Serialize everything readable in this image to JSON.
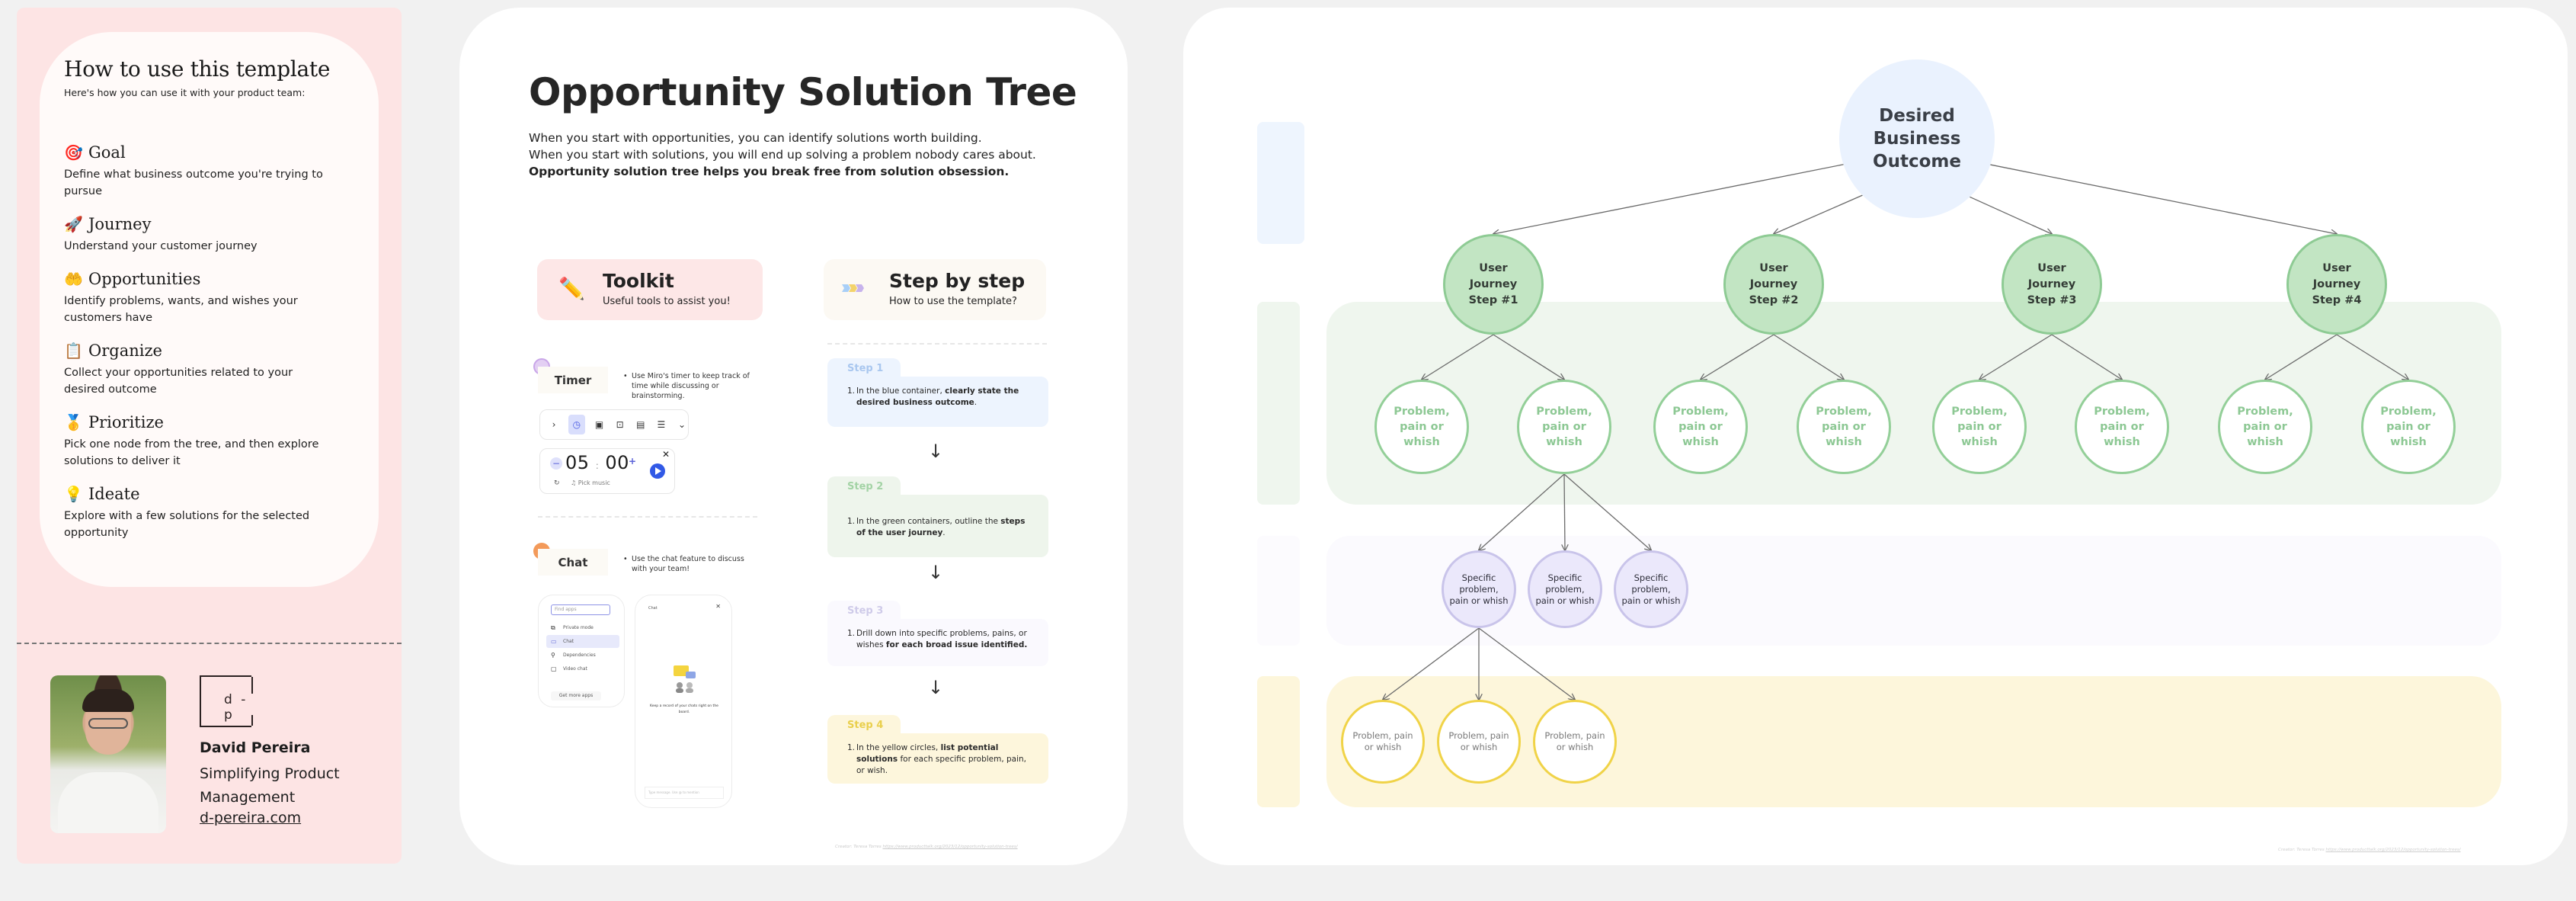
{
  "how_to": {
    "title": "How to use this template",
    "subtitle": "Here's how you can use it with your product team:",
    "items": [
      {
        "icon": "🎯",
        "icon_name": "target-icon",
        "label": "Goal",
        "desc": "Define what business outcome you're trying to pursue"
      },
      {
        "icon": "🚀",
        "icon_name": "rocket-icon",
        "label": "Journey",
        "desc": "Understand your customer journey"
      },
      {
        "icon": "🤲",
        "icon_name": "open-hands-icon",
        "label": "Opportunities",
        "desc": "Identify problems, wants, and wishes your customers have"
      },
      {
        "icon": "📋",
        "icon_name": "clipboard-icon",
        "label": "Organize",
        "desc": "Collect your opportunities related to your desired outcome"
      },
      {
        "icon": "🥇",
        "icon_name": "medal-icon",
        "label": "Prioritize",
        "desc": "Pick one node from the tree, and then explore solutions to deliver it"
      },
      {
        "icon": "💡",
        "icon_name": "lightbulb-icon",
        "label": "Ideate",
        "desc": "Explore with a few solutions for the selected opportunity"
      }
    ]
  },
  "author": {
    "logo_text": "d - p",
    "name": "David Pereira",
    "tagline": "Simplifying Product Management",
    "link": "d-pereira.com"
  },
  "intro": {
    "title": "Opportunity Solution Tree",
    "line1": "When you start with opportunities, you can identify solutions worth building.",
    "line2": "When you start with solutions, you will end up solving a problem nobody cares about.",
    "line3": "Opportunity solution tree helps you break free from solution obsession."
  },
  "toolkit": {
    "title": "Toolkit",
    "subtitle": "Useful tools to assist you!",
    "timer": {
      "label": "Timer",
      "note": "Use Miro's timer to keep track of time while discussing or brainstorming.",
      "minutes": "05",
      "seconds": "00",
      "separator": ":",
      "music_label": "Pick music",
      "toolbar_icons": [
        "chevron-right-icon",
        "timer-icon",
        "card-icon",
        "focus-icon",
        "calendar-icon",
        "notes-icon",
        "chevrons-down-icon"
      ]
    },
    "chat": {
      "label": "Chat",
      "note": "Use the chat feature to discuss with your team!",
      "apps_search_placeholder": "Find apps",
      "apps": [
        "Private mode",
        "Chat",
        "Dependencies",
        "Video chat"
      ],
      "apps_selected": "Chat",
      "get_more": "Get more apps",
      "panel_title": "Chat",
      "empty_text": "Keep a record of your chats right on the board.",
      "input_placeholder": "Type message. Use @ to mention"
    }
  },
  "steps": {
    "title": "Step by step",
    "subtitle": "How to use the template?",
    "items": [
      {
        "label": "Step 1",
        "num": "1.",
        "pre": "In the blue container, ",
        "bold": "clearly state the desired business outcome",
        "post": ".",
        "tab_color": "#a9c7ef",
        "bg": "#edf4fe"
      },
      {
        "label": "Step 2",
        "num": "1.",
        "pre": "In the green containers, outline the ",
        "bold": "steps of the user journey",
        "post": ".",
        "tab_color": "#a3d3a5",
        "bg": "#eef5ec"
      },
      {
        "label": "Step 3",
        "num": "1.",
        "pre": "Drill down into specific problems, pains, or wishes ",
        "bold": "for each broad issue identified.",
        "post": "",
        "tab_color": "#cfcbe9",
        "bg": "#faf9fe"
      },
      {
        "label": "Step 4",
        "num": "1.",
        "pre": "In the yellow circles, ",
        "bold": "list potential solutions",
        "post": " for each specific problem, pain, or wish.",
        "tab_color": "#e9cf4c",
        "bg": "#fdf6dc"
      }
    ],
    "arrow": "↓"
  },
  "credit": {
    "prefix": "Creator: ",
    "author": "Teresa Torres",
    "url": "https://www.producttalk.org/2023/12/opportunity-solution-trees/"
  },
  "tree": {
    "colors": {
      "outcome": "#eaf2fe",
      "journey": "#c2e5c3",
      "problem_border": "#93cf98",
      "specific": "#ebe8fb",
      "solution_border": "#f0d348",
      "edge": "#6b6b6b"
    },
    "root": {
      "id": "root",
      "lines": [
        "Desired",
        "Business",
        "Outcome"
      ]
    },
    "journeys": [
      {
        "id": "j1",
        "lines": [
          "User",
          "Journey",
          "Step #1"
        ]
      },
      {
        "id": "j2",
        "lines": [
          "User",
          "Journey",
          "Step #2"
        ]
      },
      {
        "id": "j3",
        "lines": [
          "User",
          "Journey",
          "Step #3"
        ]
      },
      {
        "id": "j4",
        "lines": [
          "User",
          "Journey",
          "Step #4"
        ]
      }
    ],
    "problems": [
      {
        "id": "p1",
        "parent": "j1",
        "lines": [
          "Problem,",
          "pain or",
          "whish"
        ]
      },
      {
        "id": "p2",
        "parent": "j1",
        "lines": [
          "Problem,",
          "pain or",
          "whish"
        ]
      },
      {
        "id": "p3",
        "parent": "j2",
        "lines": [
          "Problem,",
          "pain or",
          "whish"
        ]
      },
      {
        "id": "p4",
        "parent": "j2",
        "lines": [
          "Problem,",
          "pain or",
          "whish"
        ]
      },
      {
        "id": "p5",
        "parent": "j3",
        "lines": [
          "Problem,",
          "pain or",
          "whish"
        ]
      },
      {
        "id": "p6",
        "parent": "j3",
        "lines": [
          "Problem,",
          "pain or",
          "whish"
        ]
      },
      {
        "id": "p7",
        "parent": "j4",
        "lines": [
          "Problem,",
          "pain or",
          "whish"
        ]
      },
      {
        "id": "p8",
        "parent": "j4",
        "lines": [
          "Problem,",
          "pain or",
          "whish"
        ]
      }
    ],
    "specifics": [
      {
        "id": "s1",
        "parent": "p2",
        "lines": [
          "Specific",
          "problem,",
          "pain or whish"
        ]
      },
      {
        "id": "s2",
        "parent": "p2",
        "lines": [
          "Specific",
          "problem,",
          "pain or whish"
        ]
      },
      {
        "id": "s3",
        "parent": "p2",
        "lines": [
          "Specific",
          "problem,",
          "pain or whish"
        ]
      }
    ],
    "solutions": [
      {
        "id": "o1",
        "parent": "s1",
        "lines": [
          "Problem, pain",
          "or whish"
        ]
      },
      {
        "id": "o2",
        "parent": "s1",
        "lines": [
          "Problem, pain",
          "or whish"
        ]
      },
      {
        "id": "o3",
        "parent": "s1",
        "lines": [
          "Problem, pain",
          "or whish"
        ]
      }
    ]
  }
}
